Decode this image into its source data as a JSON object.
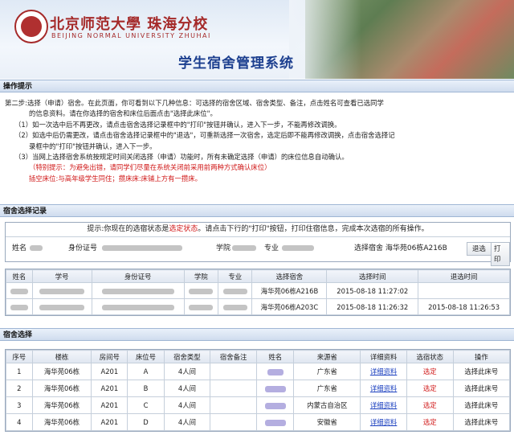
{
  "header": {
    "logo_cn": "北京师范大學 珠海分校",
    "logo_en": "BEIJING NORMAL UNIVERSITY ZHUHAI",
    "system_title": "学生宿舍管理系统"
  },
  "tips_section": {
    "title": "操作提示",
    "step2_line1": "第二步:选择（申请）宿舍。在此页面，你可看到以下几种信息：可选择的宿舍区域、宿舍类型、备注，点击姓名可查看已选同学",
    "step2_line2": "的信息资料。请在你选择的宿舍和床位后面点击\"选择此床位\"。",
    "note1": "（1）如一次选中后不再更改，请点击宿舍选择记录框中的\"打印\"按钮并确认，进入下一步，不能再修改调换。",
    "note2_line1": "（2）如选中后仍需更改，请点击宿舍选择记录框中的\"退选\"，可重新选择一次宿舍，选定后即不能再修改调换，点击宿舍选择记",
    "note2_line2": "录框中的\"打印\"按钮并确认，进入下一步。",
    "note3": "（3）当网上选择宿舍系统按规定时间关闭选择（申请）功能时，所有未确定选择（申请）的床位信息自动确认。",
    "warning": "（特别提示：为避免出错，请同学们尽量在系统关闭前采用前两种方式确认床位）",
    "insert_note": "插空床位:与高年级学生同住；攒床床:床铺上方有一攒床。"
  },
  "record_section": {
    "title": "宿舍选择记录",
    "notice_prefix": "提示:你现在的选宿状态是",
    "notice_status": "选定状态",
    "notice_suffix": "。请点击下行的\"打印\"按钮，打印住宿信息，完成本次选宿的所有操作。",
    "name_label": "姓名",
    "id_label": "身份证号",
    "college_label": "学院",
    "major_label": "专业",
    "selected_label": "选择宿舍 海华苑06栋A216B",
    "withdraw_button": "退选",
    "print_button": "打印",
    "columns": [
      "姓名",
      "学号",
      "身份证号",
      "学院",
      "专业",
      "选择宿舍",
      "选择时间",
      "退选时间"
    ],
    "rows": [
      {
        "dorm": "海华苑06栋A216B",
        "select_time": "2015-08-18 11:27:02",
        "withdraw_time": ""
      },
      {
        "dorm": "海华苑06栋A203C",
        "select_time": "2015-08-18 11:26:32",
        "withdraw_time": "2015-08-18 11:26:53"
      }
    ]
  },
  "select_section": {
    "title": "宿舍选择",
    "columns": [
      "序号",
      "楼栋",
      "房间号",
      "床位号",
      "宿舍类型",
      "宿舍备注",
      "姓名",
      "来源省",
      "详细资料",
      "选宿状态",
      "操作"
    ],
    "rows": [
      {
        "no": "1",
        "building": "海华苑06栋",
        "room": "A201",
        "bed": "A",
        "type": "4人间",
        "province": "广东省",
        "detail": "详细资料",
        "status": "选定",
        "action": "选择此床号"
      },
      {
        "no": "2",
        "building": "海华苑06栋",
        "room": "A201",
        "bed": "B",
        "type": "4人间",
        "province": "广东省",
        "detail": "详细资料",
        "status": "选定",
        "action": "选择此床号"
      },
      {
        "no": "3",
        "building": "海华苑06栋",
        "room": "A201",
        "bed": "C",
        "type": "4人间",
        "province": "内蒙古自治区",
        "detail": "详细资料",
        "status": "选定",
        "action": "选择此床号"
      },
      {
        "no": "4",
        "building": "海华苑06栋",
        "room": "A201",
        "bed": "D",
        "type": "4人间",
        "province": "安徽省",
        "detail": "详细资料",
        "status": "选定",
        "action": "选择此床号"
      }
    ]
  },
  "colors": {
    "accent_red": "#d01818",
    "title_blue": "#1c3f8f",
    "link_blue": "#1a3fbf"
  }
}
